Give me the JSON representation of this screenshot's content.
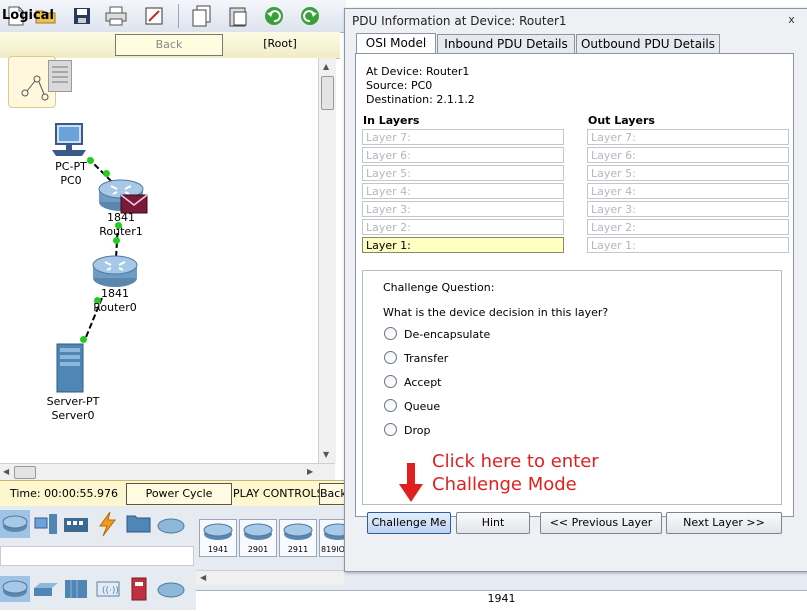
{
  "workspace": {
    "title": "Logical",
    "back_label": "Back",
    "root_label": "[Root]"
  },
  "devices": {
    "pc0": {
      "type": "PC-PT",
      "name": "PC0"
    },
    "router1": {
      "type": "1841",
      "name": "Router1"
    },
    "router0": {
      "type": "1841",
      "name": "Router0"
    },
    "server0": {
      "type": "Server-PT",
      "name": "Server0"
    }
  },
  "status": {
    "time": "Time: 00:00:55.976",
    "power_cycle": "Power Cycle Devices",
    "play_controls": "PLAY CONTROLS:",
    "back": "Back"
  },
  "tray": {
    "models": [
      "1941",
      "2901",
      "2911",
      "819IO"
    ],
    "selected_model": "1941"
  },
  "dialog": {
    "title": "PDU Information at Device: Router1",
    "close": "x",
    "tabs": [
      "OSI Model",
      "Inbound PDU Details",
      "Outbound PDU Details"
    ],
    "active_tab": "OSI Model",
    "at_device": "At Device: Router1",
    "source": "Source: PC0",
    "destination": "Destination: 2.1.1.2",
    "in_header": "In Layers",
    "out_header": "Out Layers",
    "in_layers": [
      "Layer 7:",
      "Layer 6:",
      "Layer 5:",
      "Layer 4:",
      "Layer 3:",
      "Layer 2:",
      "Layer 1:"
    ],
    "out_layers": [
      "Layer 7:",
      "Layer 6:",
      "Layer 5:",
      "Layer 4:",
      "Layer 3:",
      "Layer 2:",
      "Layer 1:"
    ],
    "selected_in_layer": "Layer 1:",
    "challenge_title": "Challenge Question:",
    "challenge_question": "What is the device decision in this layer?",
    "options": [
      "De-encapsulate",
      "Transfer",
      "Accept",
      "Queue",
      "Drop"
    ],
    "buttons": {
      "challenge": "Challenge Me",
      "hint": "Hint",
      "previous": "<< Previous Layer",
      "next": "Next Layer >>"
    }
  },
  "annotation": {
    "line1": "Click here to enter",
    "line2": "Challenge Mode",
    "color": "#e02020"
  },
  "colors": {
    "link_dot": "#22cc22",
    "selected_layer": "#ffffc4",
    "status_bg": "#fdf7d0"
  }
}
